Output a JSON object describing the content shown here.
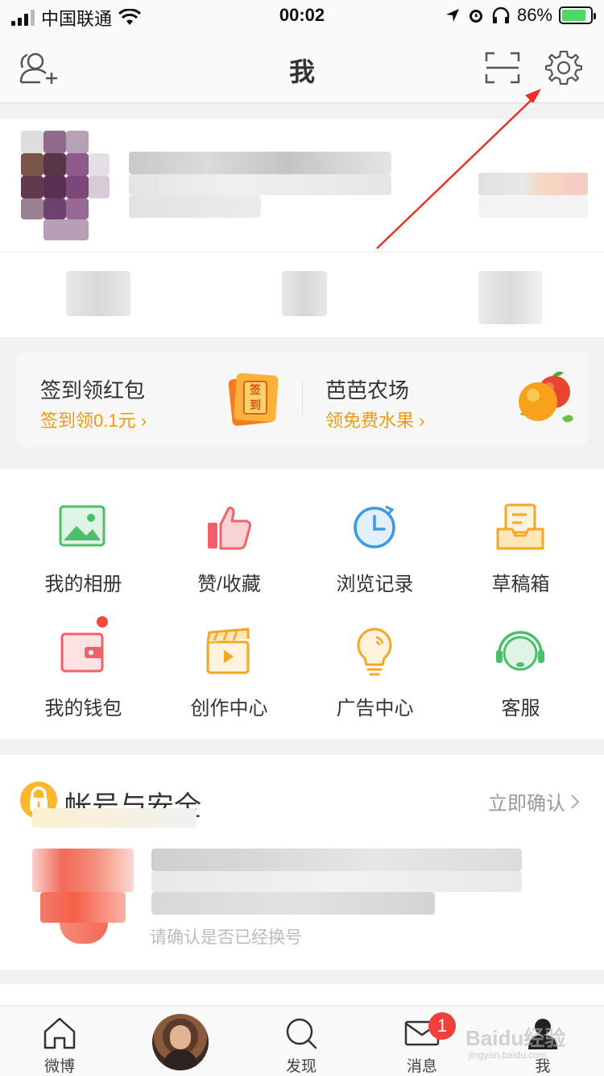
{
  "status_bar": {
    "carrier": "中国联通",
    "time": "00:02",
    "battery_percent": "86%",
    "battery_level": 0.86
  },
  "nav": {
    "title": "我",
    "add_friend_icon": "add-user-icon",
    "scan_icon": "scan-icon",
    "settings_icon": "gear-icon"
  },
  "promo": {
    "left": {
      "title": "签到领红包",
      "subtitle": "签到领0.1元 ›",
      "badge_text": "签到"
    },
    "right": {
      "title": "芭芭农场",
      "subtitle": "领免费水果 ›"
    }
  },
  "grid": [
    {
      "label": "我的相册",
      "icon": "photo-album-icon",
      "color": "#4cbf6b"
    },
    {
      "label": "赞/收藏",
      "icon": "thumbs-up-icon",
      "color": "#f0616a"
    },
    {
      "label": "浏览记录",
      "icon": "clock-icon",
      "color": "#3a9ae6"
    },
    {
      "label": "草稿箱",
      "icon": "drafts-icon",
      "color": "#f5a623"
    },
    {
      "label": "我的钱包",
      "icon": "wallet-icon",
      "color": "#f0616a"
    },
    {
      "label": "创作中心",
      "icon": "video-clapper-icon",
      "color": "#f5a623"
    },
    {
      "label": "广告中心",
      "icon": "lightbulb-icon",
      "color": "#f5a623"
    },
    {
      "label": "客服",
      "icon": "headset-icon",
      "color": "#4cbf6b"
    }
  ],
  "security": {
    "title": "帐号与安全",
    "action": "立即确认",
    "hint": "请确认是否已经换号"
  },
  "tabs": [
    {
      "label": "微博",
      "icon": "home-icon"
    },
    {
      "label": "",
      "icon": "avatar"
    },
    {
      "label": "发现",
      "icon": "search-icon"
    },
    {
      "label": "消息",
      "icon": "mail-icon",
      "badge": "1"
    },
    {
      "label": "我",
      "icon": "profile-icon"
    }
  ],
  "watermark": {
    "text": "Baidu经验",
    "sub": "jingyan.baidu.com"
  },
  "colors": {
    "accent": "#f29a0c",
    "arrow": "#e8332a"
  }
}
